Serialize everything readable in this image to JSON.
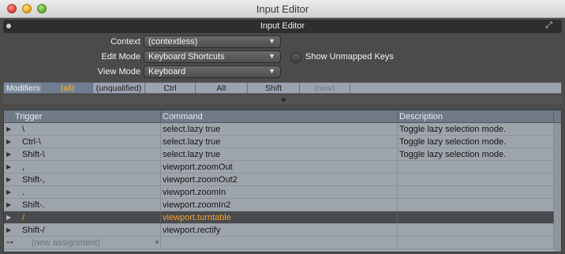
{
  "window": {
    "title": "Input Editor"
  },
  "panel": {
    "title": "Input Editor",
    "menu_icon": "panel-menu-icon",
    "expand_icon": "expand-icon"
  },
  "form": {
    "context": {
      "label": "Context",
      "value": "(contextless)"
    },
    "edit_mode": {
      "label": "Edit Mode",
      "value": "Keyboard Shortcuts"
    },
    "view_mode": {
      "label": "View Mode",
      "value": "Keyboard"
    },
    "show_unmapped": {
      "label": "Show Unmapped Keys",
      "checked": false
    }
  },
  "modifiers": {
    "label": "Modifiers",
    "tabs": [
      "(all)",
      "(unqualified)",
      "Ctrl",
      "Alt",
      "Shift",
      "(new)"
    ],
    "active": "(all)"
  },
  "table": {
    "columns": [
      "Trigger",
      "Command",
      "Description"
    ],
    "rows": [
      {
        "trigger": "\\",
        "command": "select.lazy true",
        "description": "Toggle lazy selection mode."
      },
      {
        "trigger": "Ctrl-\\",
        "command": "select.lazy true",
        "description": "Toggle lazy selection mode."
      },
      {
        "trigger": "Shift-\\",
        "command": "select.lazy true",
        "description": "Toggle lazy selection mode."
      },
      {
        "trigger": ",",
        "command": "viewport.zoomOut",
        "description": ""
      },
      {
        "trigger": "Shift-,",
        "command": "viewport.zoomOut2",
        "description": ""
      },
      {
        "trigger": ".",
        "command": "viewport.zoomIn",
        "description": ""
      },
      {
        "trigger": "Shift-.",
        "command": "viewport.zoomIn2",
        "description": ""
      },
      {
        "trigger": "/",
        "command": "viewport.turntable",
        "description": "",
        "selected": true
      },
      {
        "trigger": "Shift-/",
        "command": "viewport.rectify",
        "description": ""
      }
    ],
    "new_row_placeholder": "(new assignment)"
  },
  "colors": {
    "selected_text": "#f2a033",
    "active_tab_text": "#ffb23a"
  }
}
